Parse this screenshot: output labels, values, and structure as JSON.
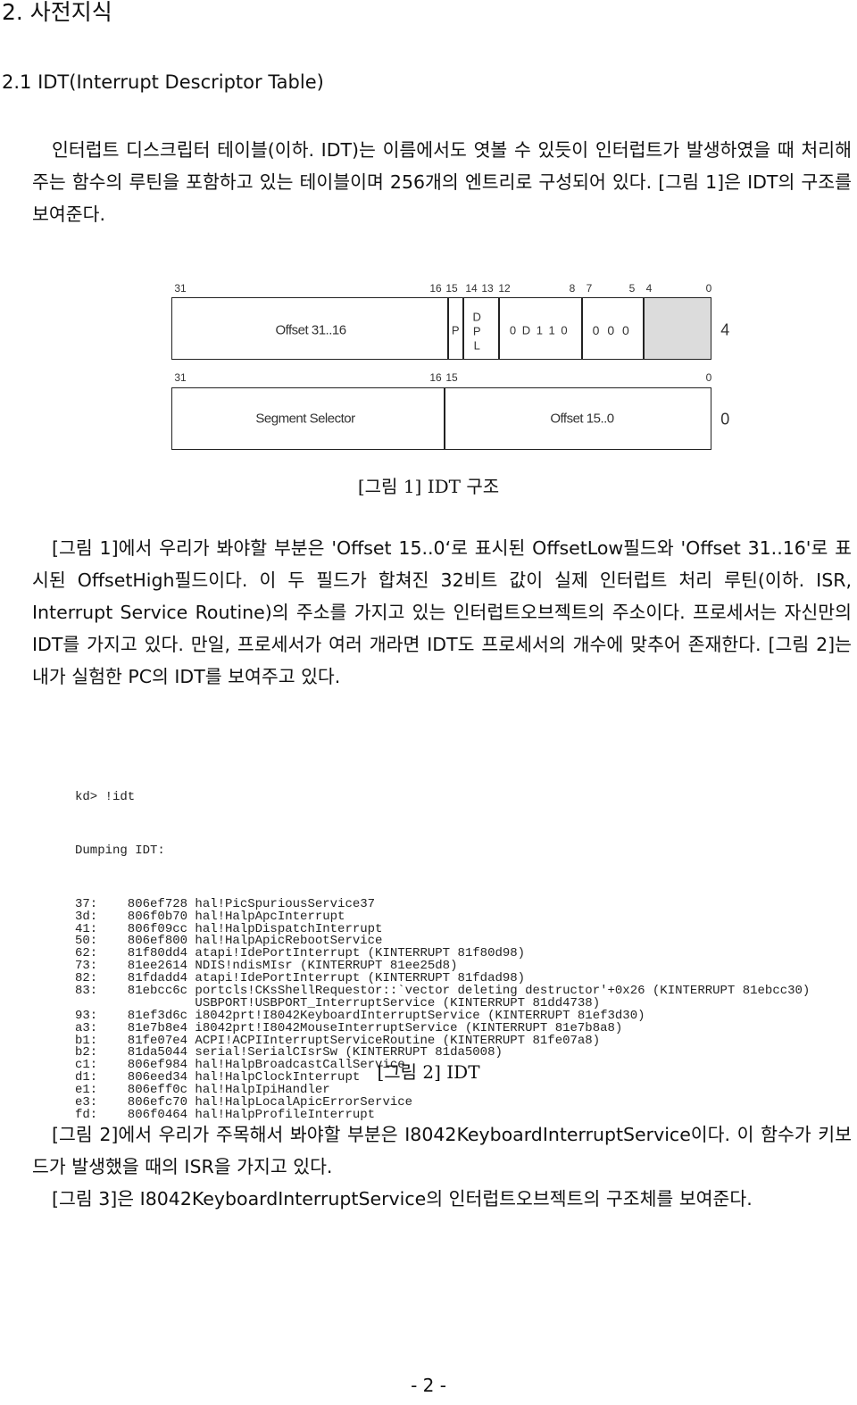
{
  "section_title": "2. 사전지식",
  "subsection_title": "2.1 IDT(Interrupt Descriptor Table)",
  "paragraph1": "인터럽트 디스크립터 테이블(이하. IDT)는 이름에서도 엿볼 수 있듯이 인터럽트가 발생하였을 때 처리해주는 함수의 루틴을 포함하고 있는 테이블이며 256개의 엔트리로 구성되어 있다. [그림 1]은 IDT의 구조를 보여준다.",
  "figure1": {
    "top_row": {
      "bits": [
        "31",
        "16",
        "15",
        "14",
        "13",
        "12",
        "8",
        "7",
        "5",
        "4",
        "0"
      ],
      "offset_high": "Offset 31..16",
      "p": "P",
      "dpl": [
        "D",
        "P",
        "L"
      ],
      "type_bits": "0 D 1 1 0",
      "zero_bits": "0 0 0",
      "byte_offset": "4"
    },
    "bottom_row": {
      "bits": [
        "31",
        "16",
        "15",
        "0"
      ],
      "segment_selector": "Segment Selector",
      "offset_low": "Offset 15..0",
      "byte_offset": "0"
    },
    "caption": "[그림 1] IDT 구조"
  },
  "paragraph2": "[그림 1]에서 우리가 봐야할 부분은 'Offset 15..0‘로 표시된 OffsetLow필드와 'Offset 31..16'로 표시된 OffsetHigh필드이다. 이 두 필드가 합쳐진 32비트 값이 실제 인터럽트 처리 루틴(이하. ISR, Interrupt Service Routine)의 주소를 가지고 있는 인터럽트오브젝트의 주소이다. 프로세서는 자신만의 IDT를 가지고 있다. 만일, 프로세서가 여러 개라면 IDT도 프로세서의 개수에 맞추어 존재한다. [그림 2]는 내가 실험한 PC의 IDT를 보여주고 있다.",
  "figure2": {
    "command": "kd> !idt",
    "header": "Dumping IDT:",
    "lines": [
      "37:    806ef728 hal!PicSpuriousService37",
      "3d:    806f0b70 hal!HalpApcInterrupt",
      "41:    806f09cc hal!HalpDispatchInterrupt",
      "50:    806ef800 hal!HalpApicRebootService",
      "62:    81f80dd4 atapi!IdePortInterrupt (KINTERRUPT 81f80d98)",
      "73:    81ee2614 NDIS!ndisMIsr (KINTERRUPT 81ee25d8)",
      "82:    81fdadd4 atapi!IdePortInterrupt (KINTERRUPT 81fdad98)",
      "83:    81ebcc6c portcls!CKsShellRequestor::`vector deleting destructor'+0x26 (KINTERRUPT 81ebcc30)",
      "                USBPORT!USBPORT_InterruptService (KINTERRUPT 81dd4738)",
      "93:    81ef3d6c i8042prt!I8042KeyboardInterruptService (KINTERRUPT 81ef3d30)",
      "a3:    81e7b8e4 i8042prt!I8042MouseInterruptService (KINTERRUPT 81e7b8a8)",
      "b1:    81fe07e4 ACPI!ACPIInterruptServiceRoutine (KINTERRUPT 81fe07a8)",
      "b2:    81da5044 serial!SerialCIsrSw (KINTERRUPT 81da5008)",
      "c1:    806ef984 hal!HalpBroadcastCallService",
      "d1:    806eed34 hal!HalpClockInterrupt",
      "e1:    806eff0c hal!HalpIpiHandler",
      "e3:    806efc70 hal!HalpLocalApicErrorService",
      "fd:    806f0464 hal!HalpProfileInterrupt"
    ],
    "caption": "[그림 2] IDT"
  },
  "paragraph3": "[그림 2]에서 우리가 주목해서 봐야할 부분은 I8042KeyboardInterruptService이다. 이 함수가 키보드가 발생했을 때의 ISR을 가지고 있다.",
  "paragraph4": "[그림 3]은 I8042KeyboardInterruptService의 인터럽트오브젝트의 구조체를 보여준다.",
  "page_number": "- 2 -",
  "colors": {
    "reserved_fill": "#dcdcdc",
    "text": "#111111"
  }
}
